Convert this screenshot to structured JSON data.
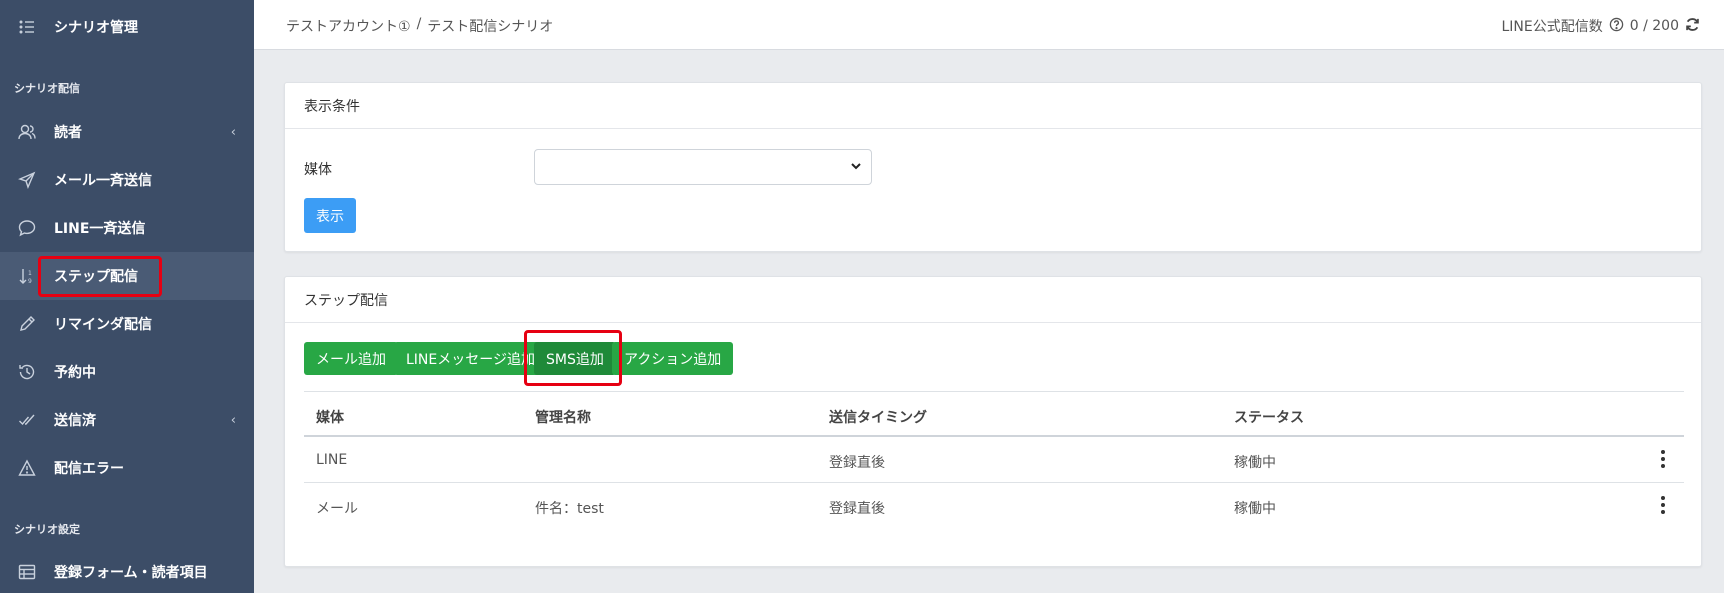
{
  "sidebar": {
    "top_item": {
      "label": "シナリオ管理",
      "icon": "list-icon"
    },
    "section1": "シナリオ配信",
    "items": [
      {
        "label": "読者",
        "icon": "users-icon",
        "chevron": "‹"
      },
      {
        "label": "メール一斉送信",
        "icon": "send-icon"
      },
      {
        "label": "LINE一斉送信",
        "icon": "chat-icon"
      },
      {
        "label": "ステップ配信",
        "icon": "sort-icon"
      },
      {
        "label": "リマインダ配信",
        "icon": "pencil-icon"
      },
      {
        "label": "予約中",
        "icon": "history-icon"
      },
      {
        "label": "送信済",
        "icon": "check-icon",
        "chevron": "‹"
      },
      {
        "label": "配信エラー",
        "icon": "warning-icon"
      }
    ],
    "section2": "シナリオ設定",
    "items2": [
      {
        "label": "登録フォーム・読者項目",
        "icon": "table-icon"
      }
    ]
  },
  "header": {
    "breadcrumb_account": "テストアカウント①",
    "breadcrumb_sep": "/",
    "breadcrumb_scenario": "テスト配信シナリオ",
    "line_count_label": "LINE公式配信数",
    "line_count_value": "0 / 200"
  },
  "filter_card": {
    "title": "表示条件",
    "media_label": "媒体",
    "media_select_value": "",
    "show_button": "表示"
  },
  "step_card": {
    "title": "ステップ配信",
    "buttons": {
      "add_mail": "メール追加",
      "add_line": "LINEメッセージ追加",
      "add_sms": "SMS追加",
      "add_action": "アクション追加"
    },
    "table": {
      "headers": [
        "媒体",
        "管理名称",
        "送信タイミング",
        "ステータス"
      ],
      "rows": [
        [
          "LINE",
          "",
          "登録直後",
          "稼働中"
        ],
        [
          "メール",
          "件名：test",
          "登録直後",
          "稼働中"
        ]
      ]
    }
  },
  "colors": {
    "sidebar_bg": "#3c4d67",
    "highlight": "#e60012",
    "green": "#28a745",
    "blue": "#3c9df5"
  }
}
